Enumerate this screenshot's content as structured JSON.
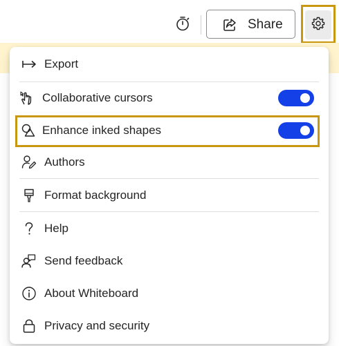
{
  "toolbar": {
    "share_label": "Share"
  },
  "menu": {
    "items": [
      {
        "label": "Export",
        "icon": "export-arrow-icon"
      },
      {
        "label": "Collaborative cursors",
        "icon": "cursor-hand-icon",
        "toggle_on": true
      },
      {
        "label": "Enhance inked shapes",
        "icon": "shapes-icon",
        "toggle_on": true
      },
      {
        "label": "Authors",
        "icon": "person-edit-icon"
      },
      {
        "label": "Format background",
        "icon": "paint-brush-icon"
      },
      {
        "label": "Help",
        "icon": "question-icon"
      },
      {
        "label": "Send feedback",
        "icon": "person-feedback-icon"
      },
      {
        "label": "About Whiteboard",
        "icon": "info-icon"
      },
      {
        "label": "Privacy and security",
        "icon": "lock-icon"
      }
    ]
  },
  "colors": {
    "toggle_on": "#1440e8",
    "highlight": "#c8960f",
    "banner": "#fff4ce"
  }
}
